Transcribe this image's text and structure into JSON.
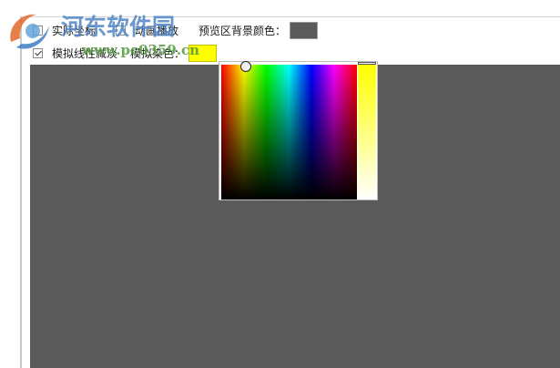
{
  "options": {
    "actual_coords_label": "实际坐标",
    "actual_coords_checked": false,
    "anim_play_label": "动画播放",
    "anim_play_checked": false,
    "preview_bg_label": "预览区背景颜色：",
    "simulate_fade_label": "模拟线性减淡",
    "simulate_fade_checked": true,
    "simulate_tint_label": "模拟染色："
  },
  "colors": {
    "preview_bg": "#5a5a5a",
    "tint": "#ffff00"
  },
  "picker": {
    "selected_color": "#ffff00",
    "hue_field_icon": "hue-saturation-field",
    "value_strip_icon": "value-strip"
  },
  "watermark": {
    "title": "河东软件园",
    "site": "www.pc0359.cn"
  }
}
